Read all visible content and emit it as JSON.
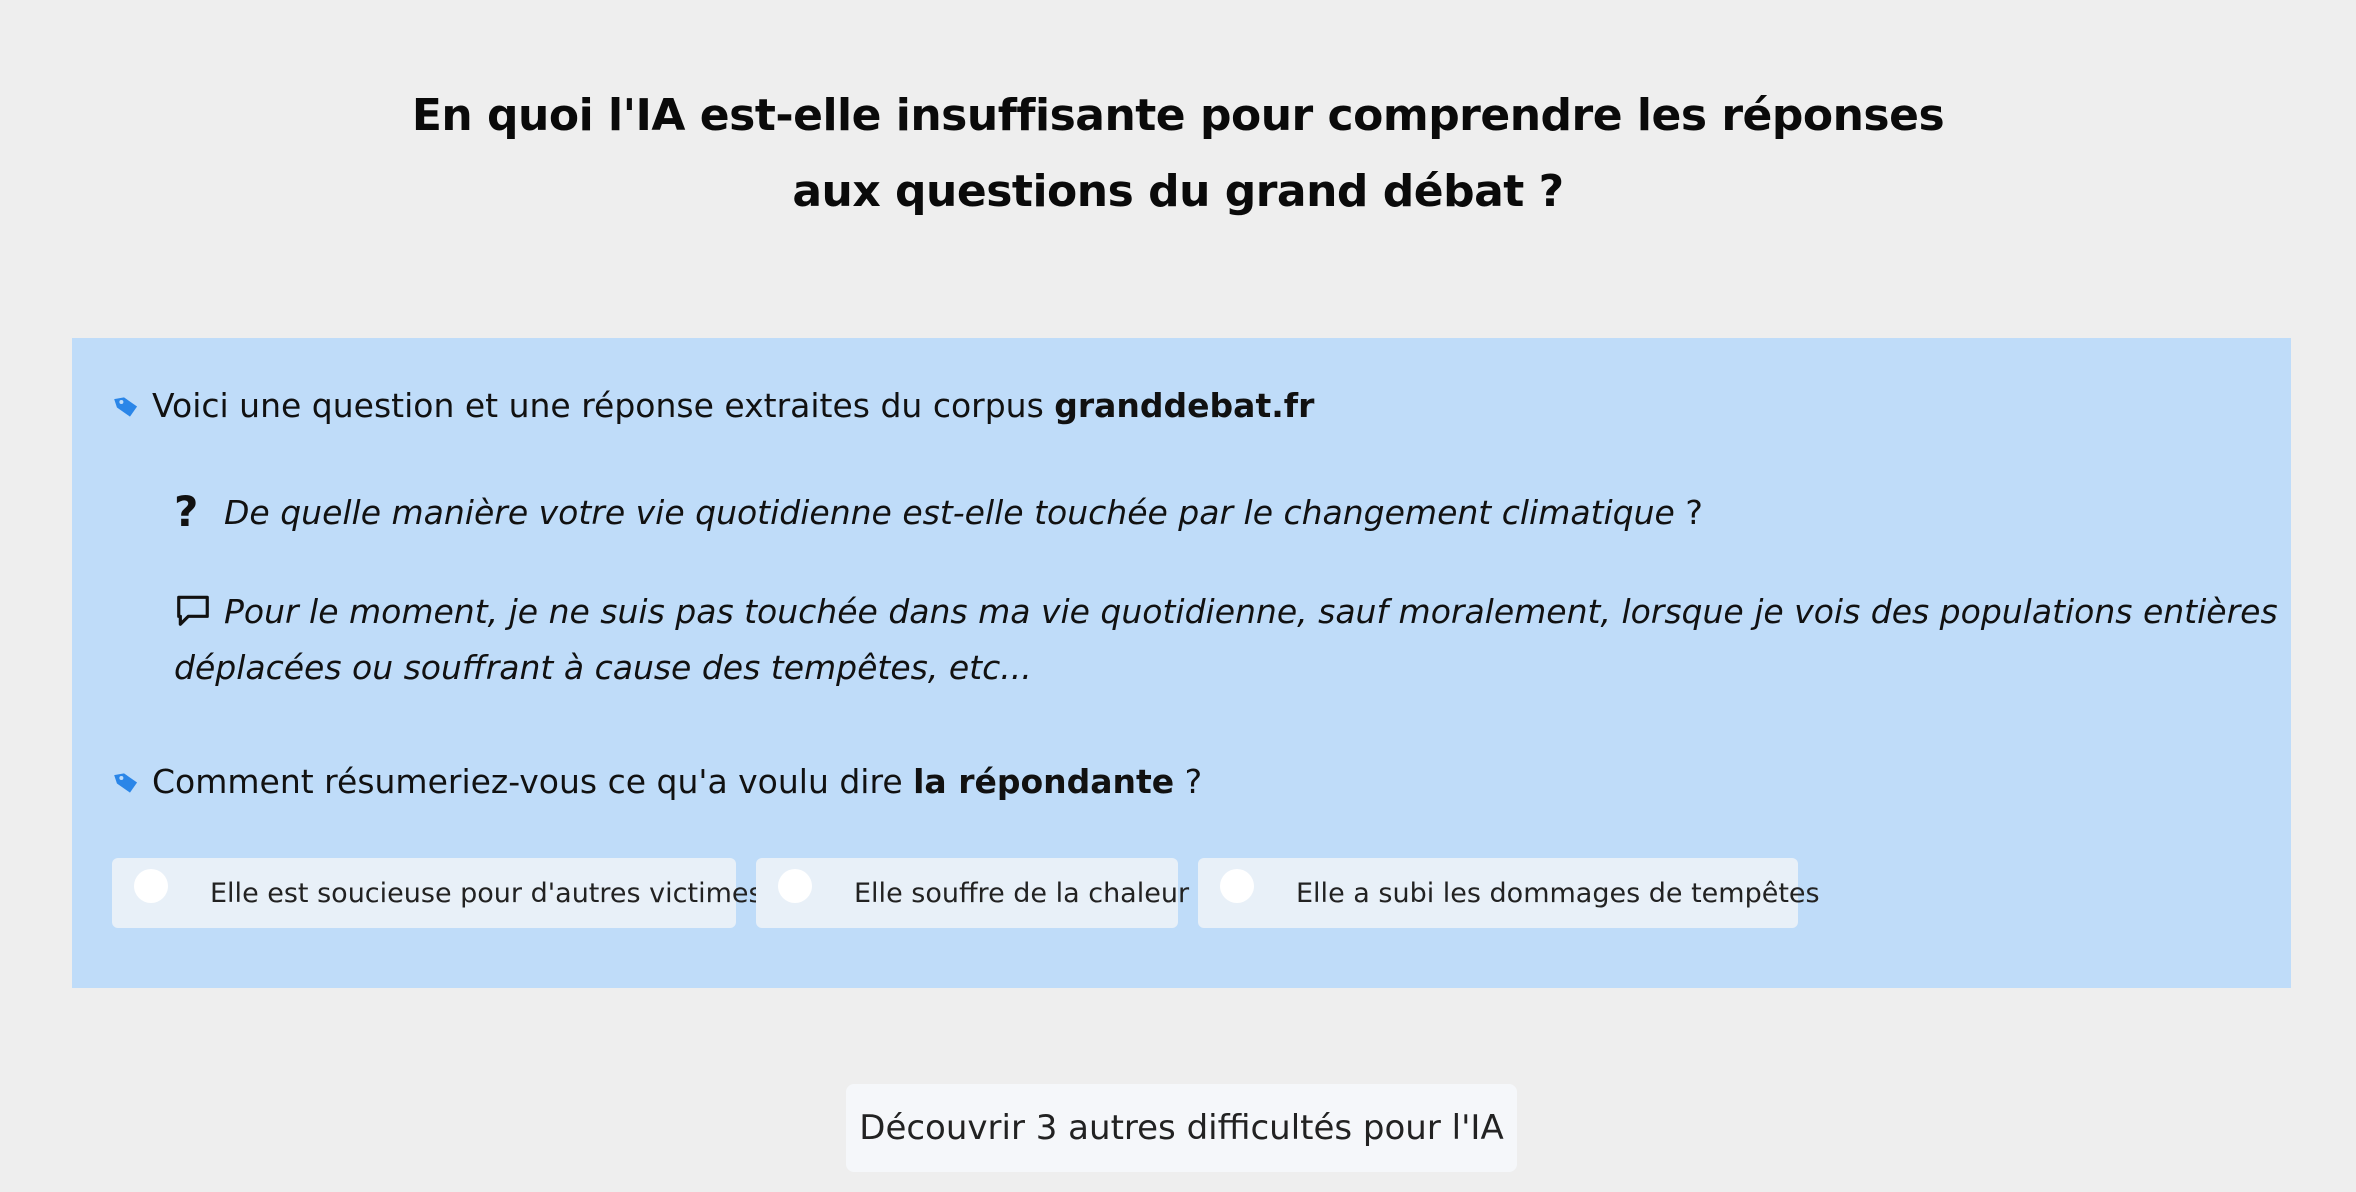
{
  "header": {
    "title_line1": "En quoi l'IA est-elle insuffisante pour comprendre les réponses",
    "title_line2": "aux questions du grand débat ?"
  },
  "card": {
    "intro_text": "Voici une question et une réponse extraites du corpus ",
    "intro_source": "granddebat.fr",
    "question_text": "De quelle manière votre vie quotidienne est-elle touchée par le changement climatique",
    "question_suffix": " ?",
    "answer_text": "Pour le moment, je ne suis pas touchée dans ma vie quotidienne, sauf moralement, lorsque je vois des populations entières déplacées ou souffrant à cause des tempêtes, etc...",
    "ask_text": "Comment résumeriez-vous ce qu'a voulu dire ",
    "ask_subject": "la répondante",
    "ask_suffix": " ?",
    "options": [
      "Elle est soucieuse pour d'autres victimes",
      "Elle souffre de la chaleur",
      "Elle a subi les dommages de tempêtes"
    ]
  },
  "footer": {
    "discover_label": "Découvrir 3 autres difficultés pour l'IA"
  },
  "colors": {
    "background": "#eeeeee",
    "panel": "#bfdcf9",
    "tag_icon": "#2b86e8",
    "option_bg": "#e8f0f8",
    "button_bg": "#f5f7fa"
  },
  "icons": {
    "intro": "tag-icon",
    "question": "question-mark-icon",
    "answer": "speech-bubble-icon",
    "ask": "tag-icon"
  }
}
